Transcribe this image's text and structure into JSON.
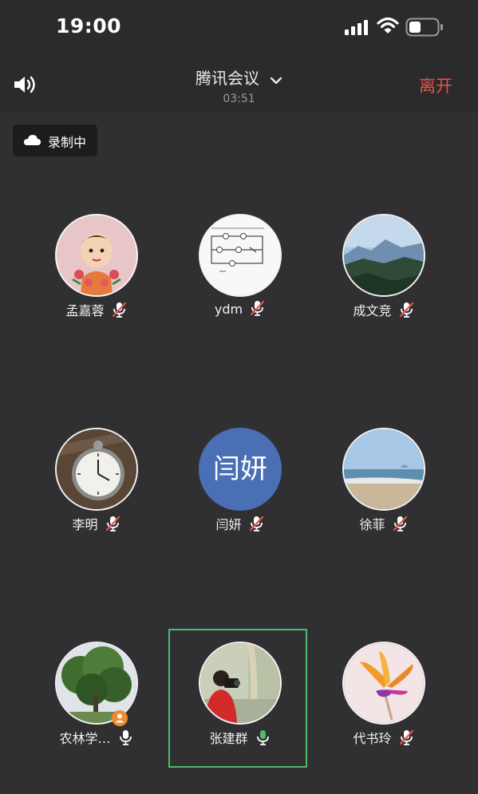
{
  "status_bar": {
    "time": "19:00"
  },
  "header": {
    "title": "腾讯会议",
    "timer": "03:51",
    "leave_label": "离开"
  },
  "recording": {
    "label": "录制中"
  },
  "participants": [
    {
      "name": "孟嘉蓉",
      "mic": "muted",
      "avatar": "baby-photo-avatar"
    },
    {
      "name": "ydm",
      "mic": "muted",
      "avatar": "circuit-diagram-avatar"
    },
    {
      "name": "成文竞",
      "mic": "muted",
      "avatar": "mountain-landscape-avatar"
    },
    {
      "name": "李明",
      "mic": "muted",
      "avatar": "pocket-watch-avatar"
    },
    {
      "name": "闫妍",
      "mic": "muted",
      "avatar_text": "闫妍",
      "avatar_color": "#4a6fb5"
    },
    {
      "name": "徐菲",
      "mic": "muted",
      "avatar": "beach-avatar"
    },
    {
      "name": "农林学…",
      "mic": "on",
      "avatar": "tree-avatar",
      "host": true
    },
    {
      "name": "张建群",
      "mic": "speaking",
      "avatar": "photographer-avatar",
      "active": true
    },
    {
      "name": "代书玲",
      "mic": "muted",
      "avatar": "flower-avatar"
    }
  ],
  "colors": {
    "leave": "#e8534b",
    "speaking": "#4dbb6a",
    "background": "#303033"
  }
}
